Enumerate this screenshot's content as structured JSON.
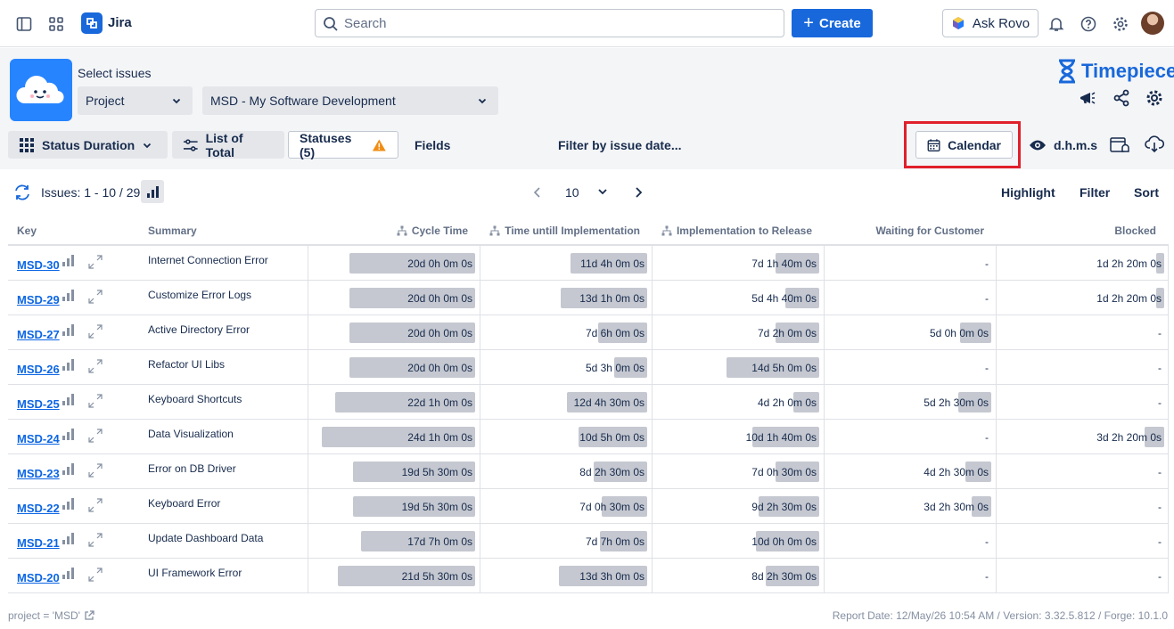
{
  "nav": {
    "app_name": "Jira",
    "search_placeholder": "Search",
    "create_label": "Create",
    "rovo_label": "Ask Rovo"
  },
  "header": {
    "select_label": "Select issues",
    "project_dropdown": "Project",
    "project_value": "MSD - My Software Development",
    "brand": "Timepiece"
  },
  "toolbar": {
    "status_duration": "Status Duration",
    "list_of_total": "List of Total",
    "statuses": "Statuses (5)",
    "fields": "Fields",
    "filter_date": "Filter by issue date...",
    "calendar": "Calendar",
    "dhms": "d.h.m.s"
  },
  "issues_bar": {
    "count": "Issues: 1 - 10 / 29",
    "page_size": "10",
    "highlight": "Highlight",
    "filter": "Filter",
    "sort": "Sort"
  },
  "columns": {
    "key": "Key",
    "summary": "Summary",
    "cycle": "Cycle Time",
    "until_impl": "Time untill Implementation",
    "impl_release": "Implementation to Release",
    "waiting": "Waiting for Customer",
    "blocked": "Blocked"
  },
  "rows": [
    {
      "key": "MSD-30",
      "summary": "Internet Connection Error",
      "vals": [
        "20d 0h 0m 0s",
        "11d 4h 0m 0s",
        "7d 1h 40m 0s",
        "-",
        "1d 2h 20m 0s"
      ],
      "fracs": [
        0.77,
        0.47,
        0.27,
        0,
        0.05
      ]
    },
    {
      "key": "MSD-29",
      "summary": "Customize Error Logs",
      "vals": [
        "20d 0h 0m 0s",
        "13d 1h 0m 0s",
        "5d 4h 40m 0s",
        "-",
        "1d 2h 20m 0s"
      ],
      "fracs": [
        0.77,
        0.53,
        0.21,
        0,
        0.05
      ]
    },
    {
      "key": "MSD-27",
      "summary": "Active Directory Error",
      "vals": [
        "20d 0h 0m 0s",
        "7d 6h 0m 0s",
        "7d 2h 0m 0s",
        "5d 0h 0m 0s",
        "-"
      ],
      "fracs": [
        0.77,
        0.3,
        0.27,
        0.19,
        0
      ]
    },
    {
      "key": "MSD-26",
      "summary": "Refactor UI Libs",
      "vals": [
        "20d 0h 0m 0s",
        "5d 3h 0m 0s",
        "14d 5h 0m 0s",
        "-",
        "-"
      ],
      "fracs": [
        0.77,
        0.2,
        0.57,
        0,
        0
      ]
    },
    {
      "key": "MSD-25",
      "summary": "Keyboard Shortcuts",
      "vals": [
        "22d 1h 0m 0s",
        "12d 4h 30m 0s",
        "4d 2h 0m 0s",
        "5d 2h 30m 0s",
        "-"
      ],
      "fracs": [
        0.86,
        0.49,
        0.16,
        0.2,
        0
      ]
    },
    {
      "key": "MSD-24",
      "summary": "Data Visualization",
      "vals": [
        "24d 1h 0m 0s",
        "10d 5h 0m 0s",
        "10d 1h 40m 0s",
        "-",
        "3d 2h 20m 0s"
      ],
      "fracs": [
        0.94,
        0.42,
        0.41,
        0,
        0.12
      ]
    },
    {
      "key": "MSD-23",
      "summary": "Error on DB Driver",
      "vals": [
        "19d 5h 30m 0s",
        "8d 2h 30m 0s",
        "7d 0h 30m 0s",
        "4d 2h 30m 0s",
        "-"
      ],
      "fracs": [
        0.75,
        0.33,
        0.27,
        0.16,
        0
      ]
    },
    {
      "key": "MSD-22",
      "summary": "Keyboard Error",
      "vals": [
        "19d 5h 30m 0s",
        "7d 0h 30m 0s",
        "9d 2h 30m 0s",
        "3d 2h 30m 0s",
        "-"
      ],
      "fracs": [
        0.75,
        0.28,
        0.37,
        0.12,
        0
      ]
    },
    {
      "key": "MSD-21",
      "summary": "Update Dashboard Data",
      "vals": [
        "17d 7h 0m 0s",
        "7d 7h 0m 0s",
        "10d 0h 0m 0s",
        "-",
        "-"
      ],
      "fracs": [
        0.7,
        0.29,
        0.39,
        0,
        0
      ]
    },
    {
      "key": "MSD-20",
      "summary": "UI Framework Error",
      "vals": [
        "21d 5h 30m 0s",
        "13d 3h 0m 0s",
        "8d 2h 30m 0s",
        "-",
        "-"
      ],
      "fracs": [
        0.84,
        0.54,
        0.33,
        0,
        0
      ]
    }
  ],
  "footer": {
    "query": "project = 'MSD'",
    "report": "Report Date: 12/May/26 10:54 AM / Version: 3.32.5.812 / Forge: 10.1.0"
  }
}
